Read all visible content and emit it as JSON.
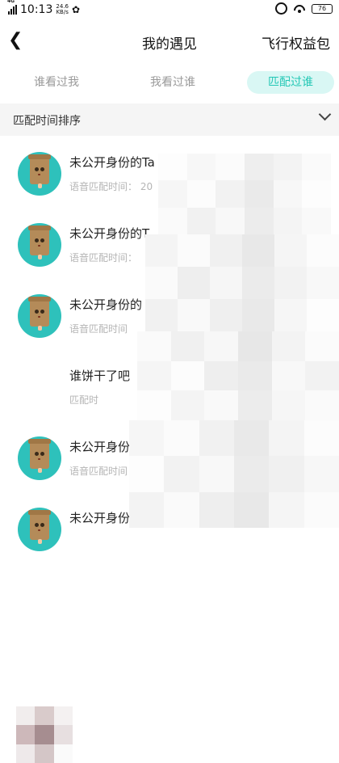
{
  "status_bar": {
    "network": "4G",
    "time": "10:13",
    "speed_value": "24.6",
    "speed_unit": "KB/s",
    "battery": "76"
  },
  "header": {
    "title": "我的遇见",
    "right_link": "飞行权益包"
  },
  "tabs": [
    {
      "label": "谁看过我",
      "active": false
    },
    {
      "label": "我看过谁",
      "active": false
    },
    {
      "label": "匹配过谁",
      "active": true
    }
  ],
  "sort": {
    "label": "匹配时间排序"
  },
  "list": [
    {
      "name": "未公开身份的Ta",
      "sub": "语音匹配时间：  20"
    },
    {
      "name": "未公开身份的T",
      "sub": "语音匹配时间："
    },
    {
      "name": "未公开身份的",
      "sub": "语音匹配时间"
    },
    {
      "name": "谁饼干了吧",
      "sub": "匹配时"
    },
    {
      "name": "未公开身份",
      "sub": "语音匹配时间："
    },
    {
      "name": "未公开身份的",
      "sub": ""
    }
  ],
  "colors": {
    "accent": "#25c8b6",
    "accent_bg": "#d9f7f4",
    "avatar_bg": "#2ec1bb"
  }
}
